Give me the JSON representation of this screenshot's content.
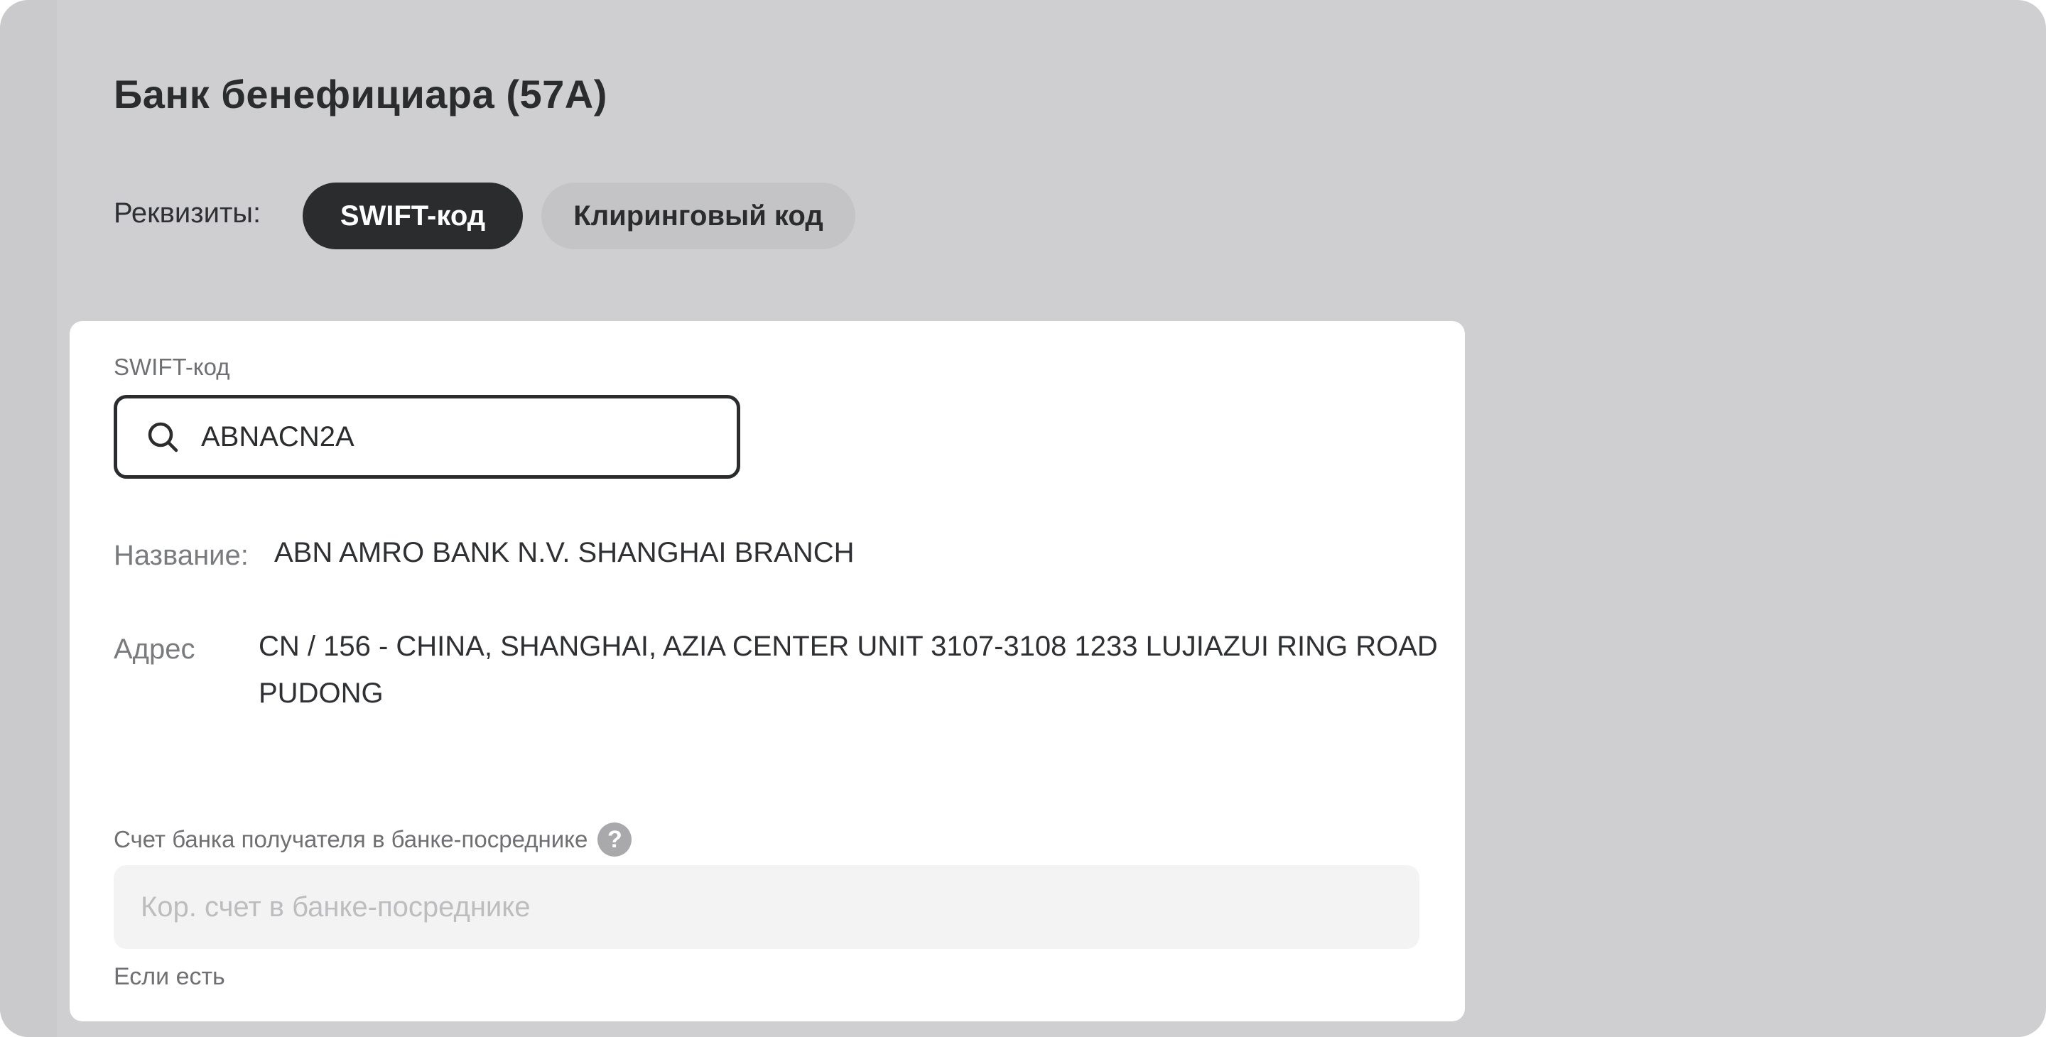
{
  "section": {
    "title": "Банк бенефициара (57А)",
    "requisites_label": "Реквизиты:",
    "toggle": {
      "options": [
        "SWIFT-код",
        "Клиринговый код"
      ],
      "selected": "SWIFT-код"
    }
  },
  "card": {
    "swift": {
      "label": "SWIFT-код",
      "value": "ABNACN2A",
      "icon": "search-icon"
    },
    "name": {
      "key": "Название:",
      "value": "ABN AMRO BANK N.V. SHANGHAI BRANCH"
    },
    "address": {
      "key": "Адрес",
      "value": "CN / 156 - CHINA, SHANGHAI, AZIA CENTER UNIT 3107-3108 1233 LUJIAZUI RING ROAD PUDONG"
    },
    "intermediary_account": {
      "label": "Счет банка получателя в банке-посреднике",
      "help_icon": "question-icon",
      "help_glyph": "?",
      "placeholder": "Кор. счет в банке-посреднике",
      "value": "",
      "hint": "Если есть"
    }
  },
  "colors": {
    "background": "#cfcfd1",
    "card": "#ffffff",
    "dark": "#2b2c2e",
    "pill_inactive": "#c4c4c6",
    "input_bg": "#f3f3f3"
  }
}
